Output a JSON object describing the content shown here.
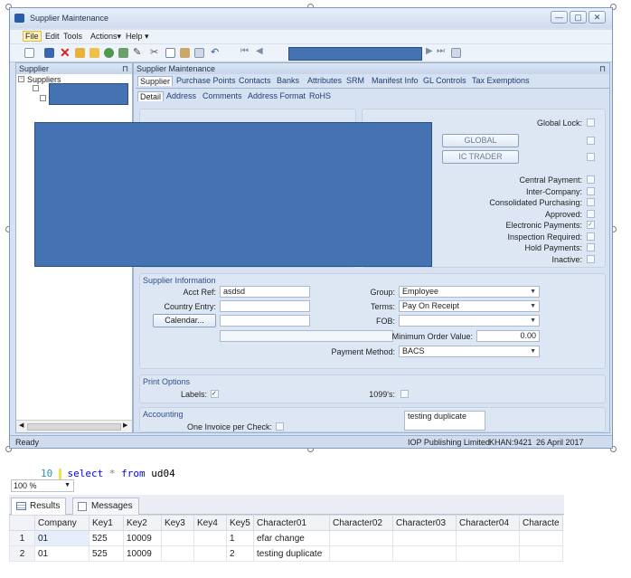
{
  "window": {
    "title": "Supplier Maintenance",
    "controls": [
      "—",
      "▢",
      "✕"
    ]
  },
  "menu": {
    "items": [
      "File",
      "Edit",
      "Tools",
      "Actions▾",
      "Help ▾"
    ]
  },
  "left_pane": {
    "title": "Supplier",
    "pin": "⊓",
    "tree_root": "Suppliers"
  },
  "main_pane": {
    "title": "Supplier Maintenance",
    "pin": "⊓",
    "tabs": [
      "Supplier",
      "Purchase Points",
      "Contacts",
      "Banks",
      "Attributes",
      "SRM",
      "Manifest Info",
      "GL Controls",
      "Tax Exemptions"
    ],
    "subtabs": [
      "Detail",
      "Address",
      "Comments",
      "Address Format",
      "RoHS"
    ]
  },
  "flags": {
    "global_lock": "Global Lock:",
    "global_button": "GLOBAL",
    "ic_trader_button": "IC TRADER",
    "checkboxes": [
      "Central Payment:",
      "Inter-Company:",
      "Consolidated Purchasing:",
      "Approved:",
      "Electronic Payments:",
      "Inspection Required:",
      "Hold Payments:",
      "Inactive:"
    ],
    "checked": [
      false,
      false,
      false,
      false,
      true,
      false,
      false,
      false
    ],
    "tick": "✓"
  },
  "supplier_info": {
    "title": "Supplier Information",
    "acct_ref_label": "Acct Ref:",
    "acct_ref_value": "asdsd",
    "country_entry_label": "Country Entry:",
    "calendar_button": "Calendar...",
    "group_label": "Group:",
    "group_value": "Employee",
    "terms_label": "Terms:",
    "terms_value": "Pay On Receipt",
    "fob_label": "FOB:",
    "min_order_label": "Minimum Order Value:",
    "min_order_value": "0.00",
    "payment_method_label": "Payment Method:",
    "payment_method_value": "BACS"
  },
  "print_options": {
    "title": "Print Options",
    "labels_label": "Labels:",
    "labels_checked": "✓",
    "label_1099": "1099's:"
  },
  "accounting": {
    "title": "Accounting",
    "one_invoice_label": "One Invoice per Check:",
    "comment_value": "testing duplicate"
  },
  "status_bar": {
    "left": "Ready",
    "company": "IOP Publishing Limited",
    "user": "KHAN:9421",
    "date": "26 April 2017"
  },
  "sql": {
    "line_number": "10",
    "keyword_select": "select",
    "star": "*",
    "keyword_from": "from",
    "table": "ud04",
    "zoom": "100 %"
  },
  "results": {
    "tabs": [
      "Results",
      "Messages"
    ],
    "columns": [
      "",
      "Company",
      "Key1",
      "Key2",
      "Key3",
      "Key4",
      "Key5",
      "Character01",
      "Character02",
      "Character03",
      "Character04",
      "Characte"
    ],
    "rows": [
      [
        "1",
        "01",
        "525",
        "10009",
        "",
        "",
        "1",
        "efar change",
        "",
        "",
        "",
        ""
      ],
      [
        "2",
        "01",
        "525",
        "10009",
        "",
        "",
        "2",
        "testing duplicate",
        "",
        "",
        "",
        ""
      ]
    ]
  },
  "colors": {
    "redaction": "#4472b2",
    "frame": "#d6e2f1",
    "sql_keyword": "#0000ff"
  }
}
